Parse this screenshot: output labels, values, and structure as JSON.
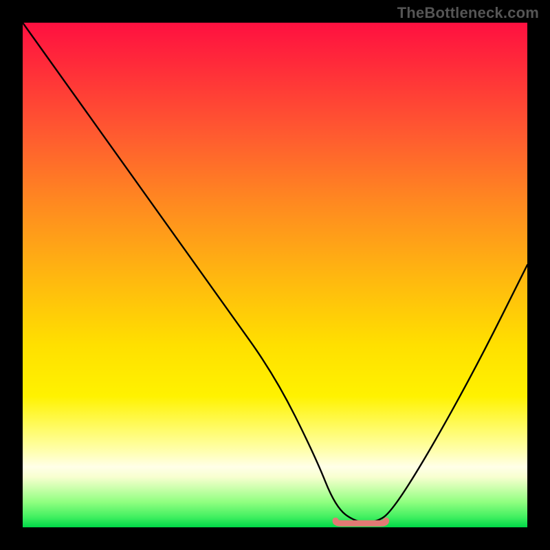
{
  "watermark": "TheBottleneck.com",
  "chart_data": {
    "type": "line",
    "title": "",
    "xlabel": "",
    "ylabel": "",
    "xlim": [
      0,
      100
    ],
    "ylim": [
      0,
      100
    ],
    "series": [
      {
        "name": "bottleneck-curve",
        "x": [
          0,
          10,
          20,
          30,
          40,
          50,
          58,
          62,
          66,
          70,
          73,
          80,
          90,
          100
        ],
        "y": [
          100,
          86,
          72,
          58,
          44,
          30,
          14,
          4,
          1,
          1,
          3,
          14,
          32,
          52
        ]
      }
    ],
    "marker": {
      "name": "optimal-range",
      "color": "#e27a74",
      "x_start": 62,
      "x_end": 72,
      "y": 1.2
    },
    "background_gradient": {
      "top": "#ff1040",
      "mid": "#ffe000",
      "bottom": "#00d848"
    }
  }
}
